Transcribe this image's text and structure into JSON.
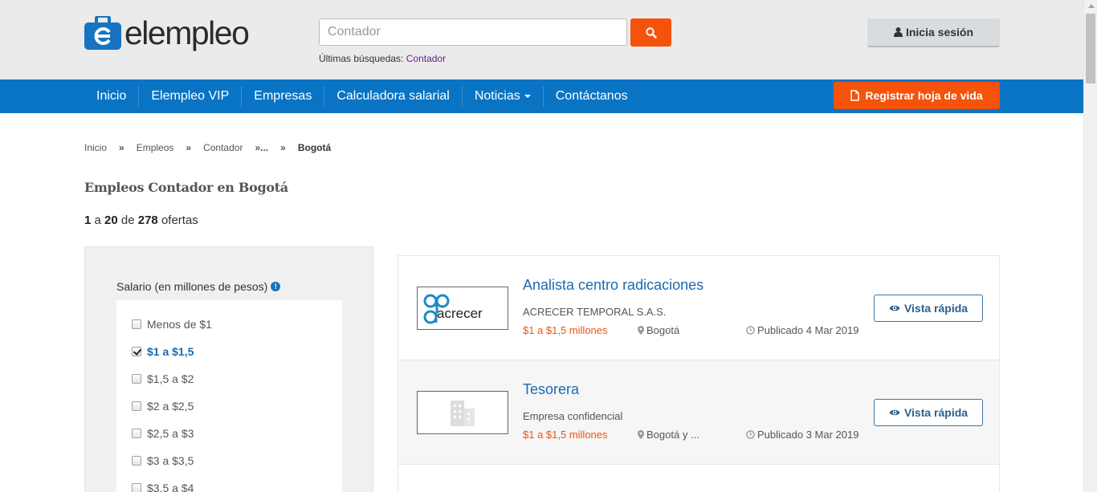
{
  "header": {
    "logo_text": "elempleo",
    "search_placeholder": "Contador",
    "recent_label": "Últimas búsquedas:",
    "recent_link": "Contador",
    "login_label": "Inicia sesión"
  },
  "nav": {
    "items": [
      "Inicio",
      "Elempleo VIP",
      "Empresas",
      "Calculadora salarial",
      "Noticias",
      "Contáctanos"
    ],
    "register_label": "Registrar hoja de vida"
  },
  "breadcrumb": {
    "items": [
      "Inicio",
      "Empleos",
      "Contador"
    ],
    "ellipsis": "...",
    "separator": "»",
    "current": "Bogotá"
  },
  "page_title": "Empleos Contador en Bogotá",
  "results": {
    "from": "1",
    "to": "20",
    "total": "278",
    "word_a": "a",
    "word_de": "de",
    "word_ofertas": "ofertas"
  },
  "filters": {
    "title": "Salario (en millones de pesos)",
    "options": [
      {
        "label": "Menos de $1",
        "checked": false
      },
      {
        "label": "$1 a $1,5",
        "checked": true
      },
      {
        "label": "$1,5 a $2",
        "checked": false
      },
      {
        "label": "$2 a $2,5",
        "checked": false
      },
      {
        "label": "$2,5 a $3",
        "checked": false
      },
      {
        "label": "$3 a $3,5",
        "checked": false
      },
      {
        "label": "$3,5 a $4",
        "checked": false
      }
    ]
  },
  "jobs": [
    {
      "title": "Analista centro radicaciones",
      "company": "ACRECER TEMPORAL S.A.S.",
      "salary": "$1 a $1,5 millones",
      "location": "Bogotá",
      "date": "Publicado 4 Mar 2019",
      "logo_text": "acrecer",
      "quick_label": "Vista rápida"
    },
    {
      "title": "Tesorera",
      "company": "Empresa confidencial",
      "salary": "$1 a $1,5 millones",
      "location": "Bogotá y ...",
      "date": "Publicado 3 Mar 2019",
      "logo_text": "",
      "quick_label": "Vista rápida"
    }
  ],
  "colors": {
    "primary_blue": "#0a74c4",
    "accent_orange": "#f5520b",
    "link_blue": "#1a6ab2"
  }
}
